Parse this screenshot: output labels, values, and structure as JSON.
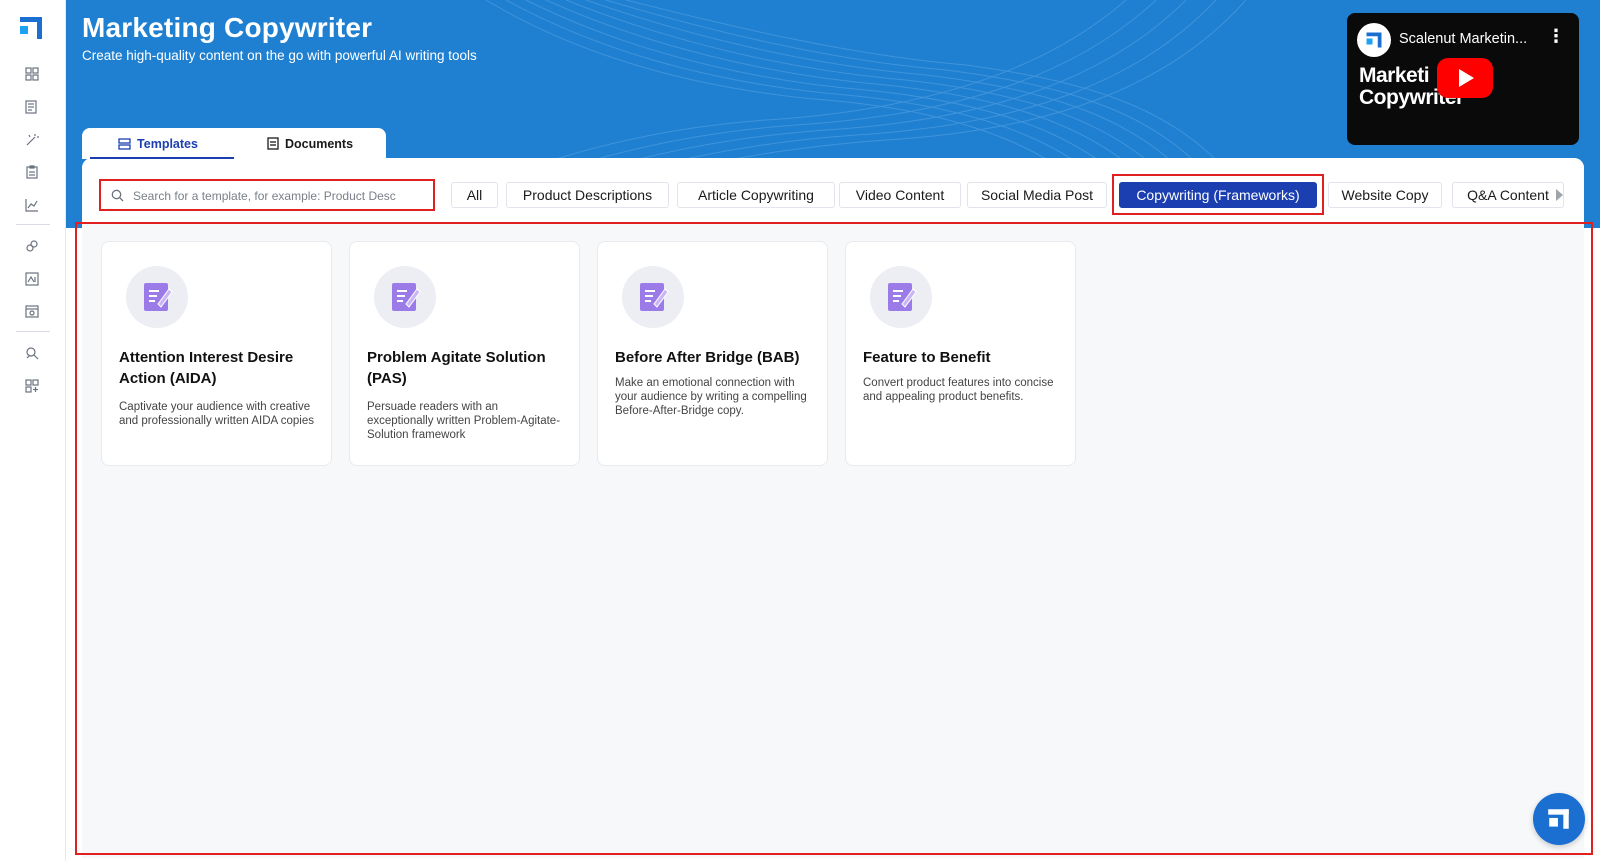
{
  "header": {
    "title": "Marketing Copywriter",
    "subtitle": "Create high-quality content on the go with powerful AI writing tools"
  },
  "video": {
    "channel_title": "Scalenut Marketin...",
    "thumbnail_text_line1": "Marketi",
    "thumbnail_text_line2": "Copywriter",
    "icons": [
      "scalenut-logo-icon",
      "more-options-icon",
      "youtube-play-icon"
    ]
  },
  "tabs": [
    {
      "label": "Templates",
      "icon": "templates-icon",
      "active": true
    },
    {
      "label": "Documents",
      "icon": "documents-icon",
      "active": false
    }
  ],
  "search": {
    "placeholder": "Search for a template, for example: Product Desc",
    "value": ""
  },
  "categories": [
    {
      "label": "All",
      "active": false
    },
    {
      "label": "Product Descriptions",
      "active": false
    },
    {
      "label": "Article Copywriting",
      "active": false
    },
    {
      "label": "Video Content",
      "active": false
    },
    {
      "label": "Social Media Post",
      "active": false
    },
    {
      "label": "Copywriting (Frameworks)",
      "active": true
    },
    {
      "label": "Website Copy",
      "active": false
    },
    {
      "label": "Q&A Content",
      "active": false
    }
  ],
  "cards": [
    {
      "title": "Attention Interest Desire Action (AIDA)",
      "description": "Captivate your audience with creative and professionally written AIDA copies"
    },
    {
      "title": "Problem Agitate Solution (PAS)",
      "description": "Persuade readers with an exceptionally written Problem-Agitate-Solution framework"
    },
    {
      "title": "Before After Bridge (BAB)",
      "description": "Make an emotional connection with your audience by writing a compelling Before-After-Bridge copy."
    },
    {
      "title": "Feature to Benefit",
      "description": "Convert product features into concise and appealing product benefits."
    }
  ],
  "sidebar": {
    "icons": [
      "scalenut-logo-icon",
      "dashboard-icon",
      "document-edit-icon",
      "magic-wand-icon",
      "clipboard-icon",
      "analytics-chart-icon",
      "link-icon",
      "ai-image-icon",
      "calendar-settings-icon",
      "ai-search-icon",
      "apps-grid-icon"
    ]
  },
  "colors": {
    "brand_blue": "#1f80d1",
    "active_chip": "#1b3fb0",
    "highlight_red": "#e02020",
    "card_icon_purple": "#9b7be8"
  }
}
